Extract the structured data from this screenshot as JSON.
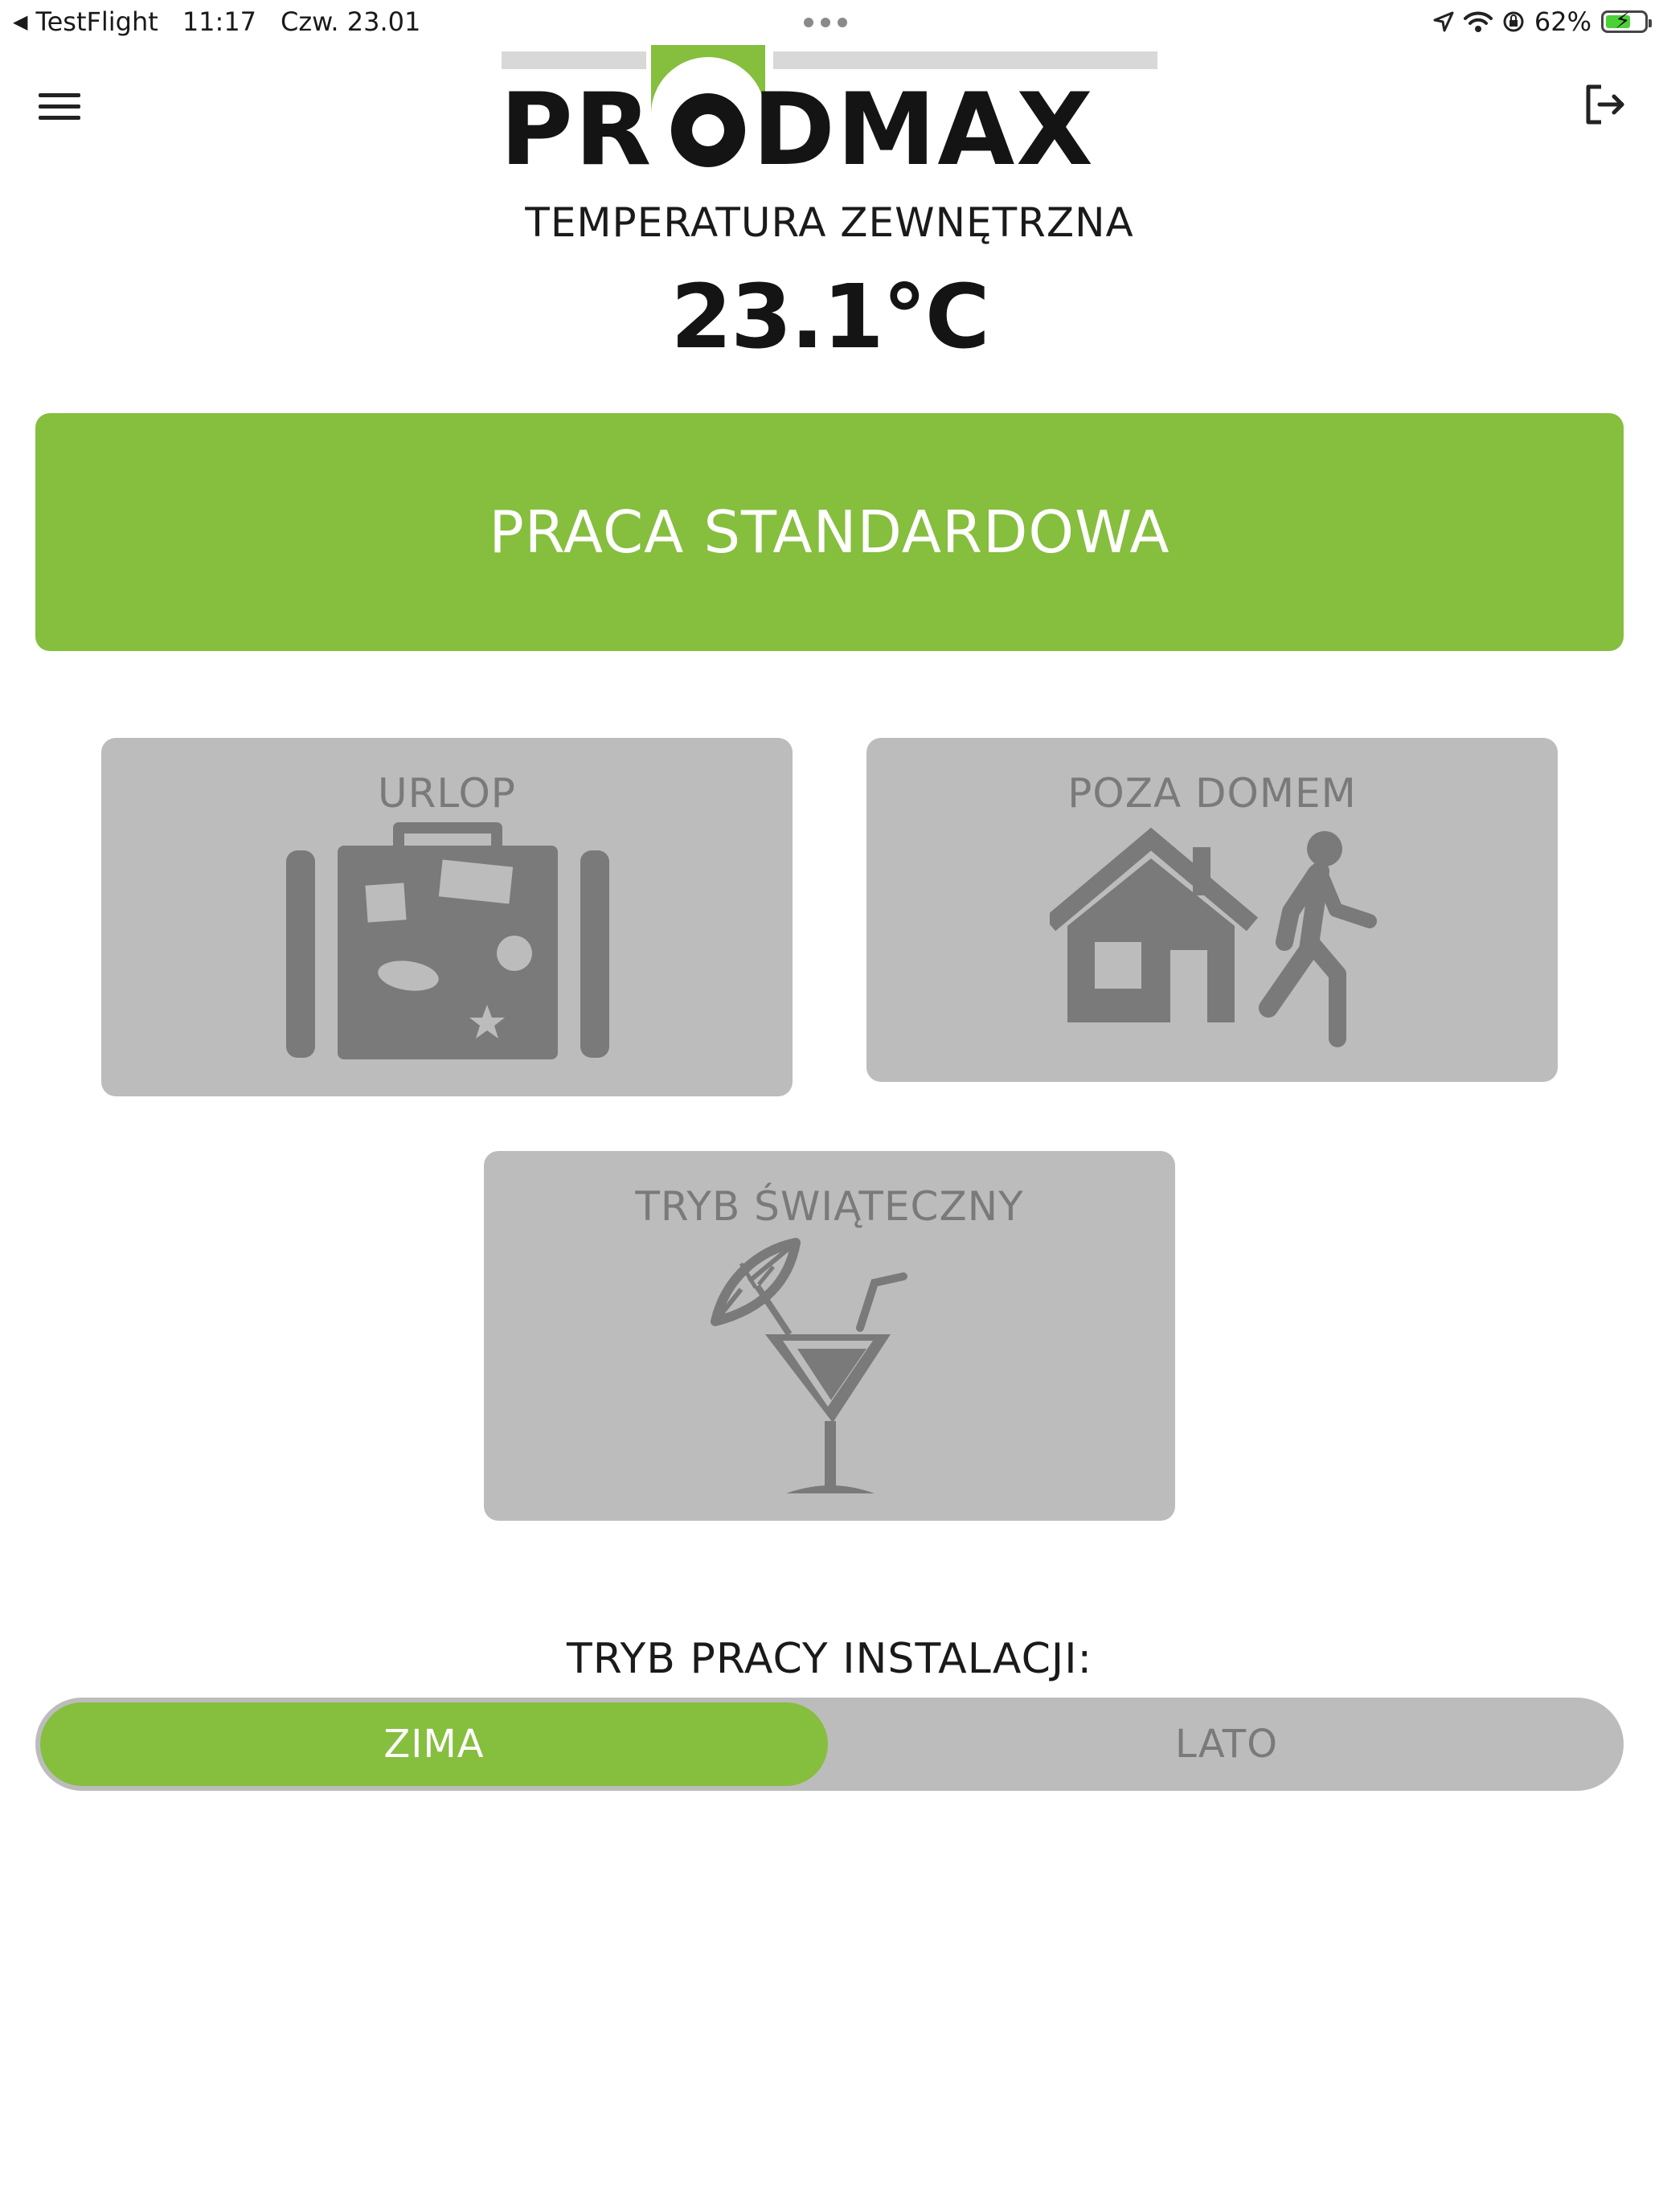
{
  "status_bar": {
    "back_app": "TestFlight",
    "time": "11:17",
    "date": "Czw. 23.01",
    "battery": "62%",
    "battery_level": 0.62
  },
  "header": {
    "logo_text": "PRODMAX",
    "temperature_label": "TEMPERATURA ZEWNĘTRZNA",
    "temperature_value": "23.1°C"
  },
  "main_mode": {
    "label": "PRACA STANDARDOWA",
    "color": "#86be3e"
  },
  "tiles": [
    {
      "label": "URLOP",
      "icon": "suitcase-icon"
    },
    {
      "label": "POZA DOMEM",
      "icon": "house-walking-person-icon"
    },
    {
      "label": "TRYB ŚWIĄTECZNY",
      "icon": "cocktail-icon"
    }
  ],
  "install_mode": {
    "title": "TRYB PRACY INSTALACJI:",
    "options": [
      "ZIMA",
      "LATO"
    ],
    "selected": "ZIMA"
  },
  "colors": {
    "accent_green": "#86be3e",
    "tile_gray": "#bcbcbc",
    "icon_gray": "#7a7a7a"
  }
}
